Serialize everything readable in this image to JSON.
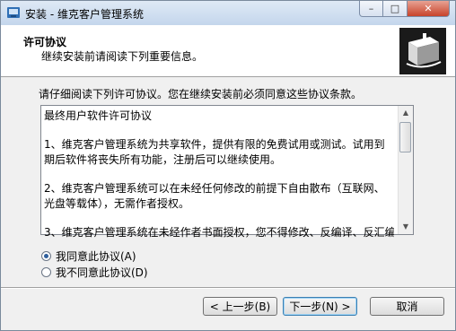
{
  "window": {
    "title": "安装 - 维克客户管理系统"
  },
  "header": {
    "title": "许可协议",
    "subtitle": "继续安装前请阅读下列重要信息。"
  },
  "intro": "请仔细阅读下列许可协议。您在继续安装前必须同意这些协议条款。",
  "license": {
    "paragraphs": [
      "最终用户软件许可协议",
      "1、维克客户管理系统为共享软件，提供有限的免费试用或测试。试用到期后软件将丧失所有功能，注册后可以继续使用。",
      "2、维克客户管理系统可以在未经任何修改的前提下自由散布（互联网、光盘等载体），无需作者授权。",
      "3、维克客户管理系统在未经作者书面授权，您不得修改、反编译、反汇编"
    ]
  },
  "options": {
    "accept": "我同意此协议(A)",
    "decline": "我不同意此协议(D)",
    "selected": "accept"
  },
  "buttons": {
    "back": "< 上一步(B)",
    "next": "下一步(N) >",
    "cancel": "取消"
  }
}
